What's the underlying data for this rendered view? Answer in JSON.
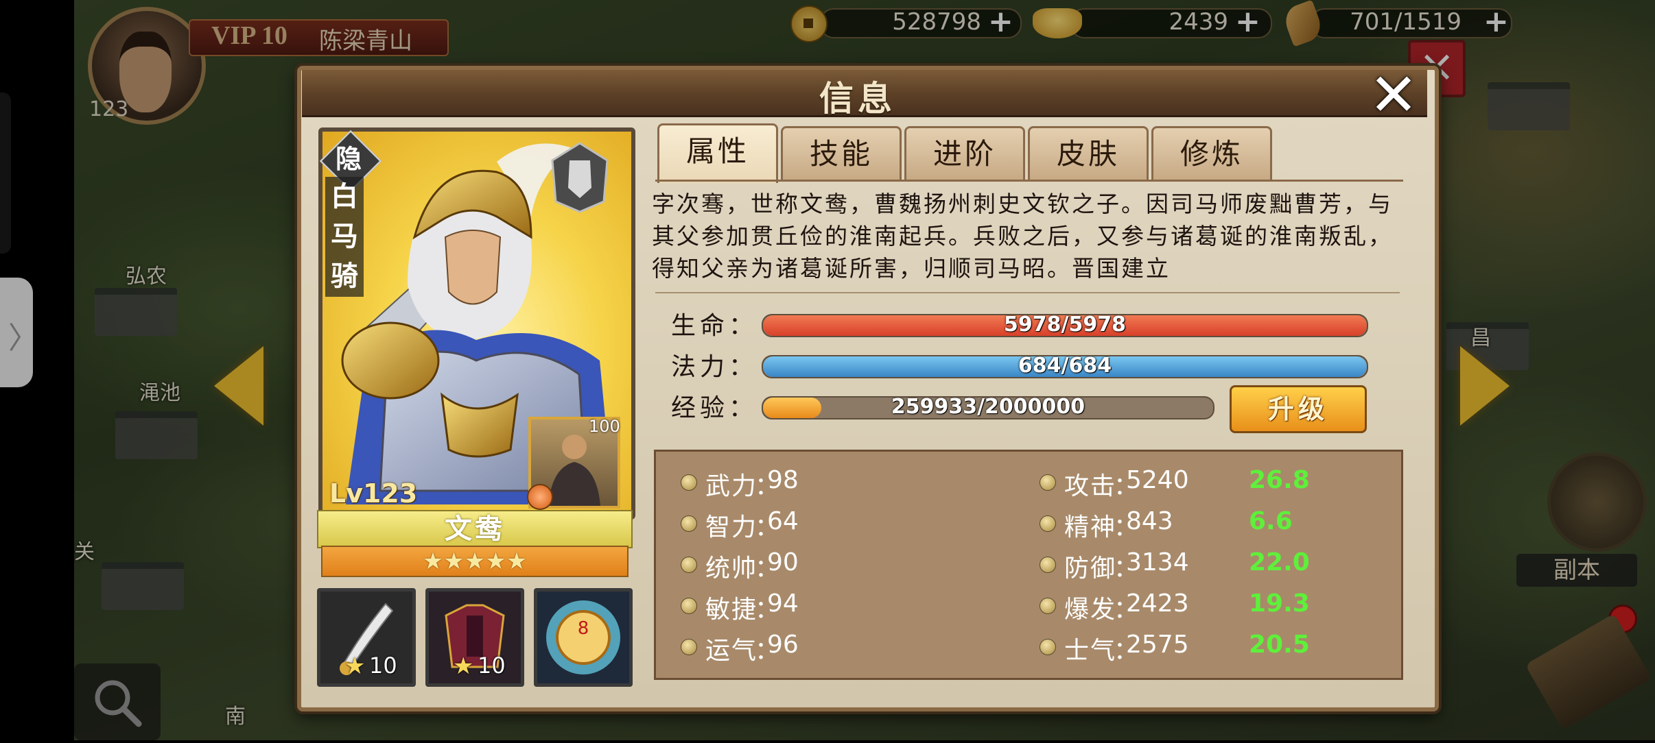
{
  "player": {
    "vip": "VIP 10",
    "name": "陈梁青山",
    "level": "123"
  },
  "resources": {
    "coins": "528798",
    "gold": "2439",
    "food": "701/1519"
  },
  "map_labels": [
    "弘农",
    "渑池",
    "南",
    "关",
    "昌"
  ],
  "modal": {
    "title": "信息",
    "tabs": [
      "属性",
      "技能",
      "进阶",
      "皮肤",
      "修炼"
    ],
    "active_tab": "属性",
    "bio": "字次骞，世称文鸯，曹魏扬州刺史文钦之子。因司马师废黜曹芳，与其父参加贯丘俭的淮南起兵。兵败之后，又参与诸葛诞的淮南叛乱，得知父亲为诸葛诞所害，归顺司马昭。晋国建立"
  },
  "hero": {
    "badge": "隐",
    "title_vertical": "白马骑",
    "level": "Lv123",
    "name": "文鸯",
    "stars": "★★★★★",
    "mount_level": "100",
    "equipment": [
      {
        "icon": "sword-icon",
        "level": "10"
      },
      {
        "icon": "armor-icon",
        "level": "10"
      },
      {
        "icon": "medal-icon",
        "level": "8"
      }
    ]
  },
  "bars": {
    "hp": {
      "label": "生命：",
      "text": "5978/5978",
      "fraction": 1.0,
      "color": "#e8583a"
    },
    "mp": {
      "label": "法力：",
      "text": "684/684",
      "fraction": 1.0,
      "color": "#4a9ad6"
    },
    "exp": {
      "label": "经验：",
      "text": "259933/2000000",
      "fraction": 0.13,
      "color": "#f0a630"
    },
    "upgrade_label": "升级"
  },
  "attributes_left": [
    {
      "name": "武力",
      "value": "98"
    },
    {
      "name": "智力",
      "value": "64"
    },
    {
      "name": "统帅",
      "value": "90"
    },
    {
      "name": "敏捷",
      "value": "94"
    },
    {
      "name": "运气",
      "value": "96"
    }
  ],
  "attributes_right": [
    {
      "name": "攻击",
      "value": "5240",
      "growth": "26.8"
    },
    {
      "name": "精神",
      "value": "843",
      "growth": "6.6"
    },
    {
      "name": "防御",
      "value": "3134",
      "growth": "22.0"
    },
    {
      "name": "爆发",
      "value": "2423",
      "growth": "19.3"
    },
    {
      "name": "士气",
      "value": "2575",
      "growth": "20.5"
    }
  ],
  "side": {
    "dungeon_label": "副本"
  }
}
